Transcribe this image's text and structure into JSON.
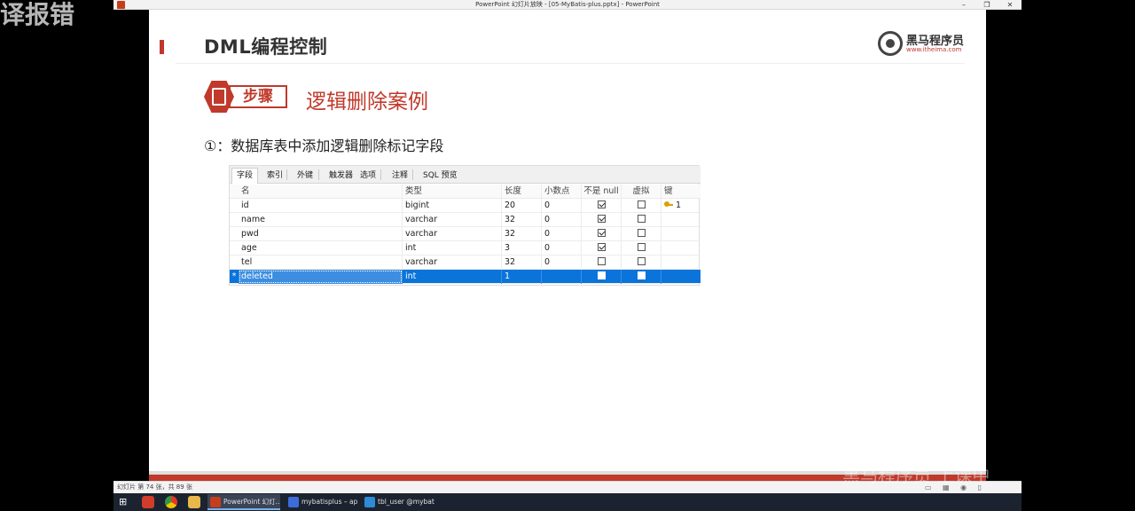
{
  "overlay_left_text": "译报错",
  "window": {
    "title": "PowerPoint 幻灯片放映 - [05-MyBatis-plus.pptx] - PowerPoint",
    "controls": [
      "–",
      "❐",
      "✕"
    ]
  },
  "slide": {
    "title": "DML编程控制",
    "logo": {
      "cn": "黑马程序员",
      "en": "www.itheima.com"
    },
    "step_label": "步骤",
    "case_title": "逻辑删除案例",
    "step_desc": "①：数据库表中添加逻辑删除标记字段"
  },
  "table": {
    "tabs": [
      "字段",
      "索引",
      "外键",
      "触发器",
      "选项",
      "注释",
      "SQL 预览"
    ],
    "active_tab": "字段",
    "columns": [
      "名",
      "类型",
      "长度",
      "小数点",
      "不是 null",
      "虚拟",
      "键"
    ],
    "rows": [
      {
        "name": "id",
        "type": "bigint",
        "length": "20",
        "decimal": "0",
        "not_null": true,
        "virtual": false,
        "key": "1",
        "marker": ""
      },
      {
        "name": "name",
        "type": "varchar",
        "length": "32",
        "decimal": "0",
        "not_null": true,
        "virtual": false,
        "key": "",
        "marker": ""
      },
      {
        "name": "pwd",
        "type": "varchar",
        "length": "32",
        "decimal": "0",
        "not_null": true,
        "virtual": false,
        "key": "",
        "marker": ""
      },
      {
        "name": "age",
        "type": "int",
        "length": "3",
        "decimal": "0",
        "not_null": true,
        "virtual": false,
        "key": "",
        "marker": ""
      },
      {
        "name": "tel",
        "type": "varchar",
        "length": "32",
        "decimal": "0",
        "not_null": false,
        "virtual": false,
        "key": "",
        "marker": ""
      },
      {
        "name": "deleted",
        "type": "int",
        "length": "1",
        "decimal": "",
        "not_null": false,
        "virtual": false,
        "key": "",
        "marker": "*",
        "selected": true
      }
    ]
  },
  "statusbar": {
    "text": "幻灯片 第 74 张，共 89 张"
  },
  "taskbar": {
    "items": [
      {
        "label": "PowerPoint 幻灯...",
        "active": true,
        "color": "#c43e1c"
      },
      {
        "label": "mybatisplus – ap...",
        "active": false,
        "color": "#3d6bd9"
      },
      {
        "label": "tbl_user @mybati...",
        "active": false,
        "color": "#2e8bd6"
      }
    ]
  },
  "overlay_right_text": "黑马程序员 上课中"
}
